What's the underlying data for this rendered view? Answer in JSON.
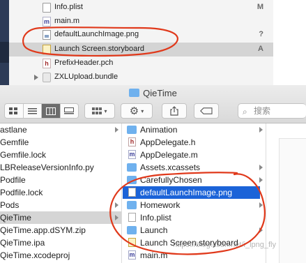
{
  "navigator": {
    "items": [
      {
        "label": "Info.plist",
        "badge": "M",
        "icon": "plist-file-icon"
      },
      {
        "label": "main.m",
        "badge": "",
        "icon": "m-file-icon"
      },
      {
        "label": "defaultLaunchImage.png",
        "badge": "?",
        "icon": "png-file-icon"
      },
      {
        "label": "Launch Screen.storyboard",
        "badge": "A",
        "icon": "storyboard-file-icon"
      },
      {
        "label": "PrefixHeader.pch",
        "badge": "",
        "icon": "h-file-icon"
      },
      {
        "label": "ZXLUpload.bundle",
        "badge": "",
        "icon": "bundle-icon"
      }
    ],
    "selected_index": 3
  },
  "finder": {
    "title": "QieTime",
    "search_placeholder": "搜索",
    "toolbar": {
      "view_modes": [
        "icon-view",
        "list-view",
        "column-view",
        "cover-flow-view"
      ],
      "active_view": "column-view",
      "arrange_icon": "grid-arrange-icon",
      "action_icon": "gear-icon",
      "share_icon": "share-icon",
      "tag_icon": "tag-icon"
    },
    "column1": [
      {
        "label": "astlane",
        "has_children": true
      },
      {
        "label": "Gemfile",
        "has_children": false
      },
      {
        "label": "Gemfile.lock",
        "has_children": false
      },
      {
        "label": "LBReleaseVersionInfo.py",
        "has_children": false
      },
      {
        "label": "Podfile",
        "has_children": false
      },
      {
        "label": "Podfile.lock",
        "has_children": false
      },
      {
        "label": "Pods",
        "has_children": true
      },
      {
        "label": "QieTime",
        "has_children": true
      },
      {
        "label": "QieTime.app.dSYM.zip",
        "has_children": false
      },
      {
        "label": "QieTime.ipa",
        "has_children": false
      },
      {
        "label": "QieTime.xcodeproj",
        "has_children": false
      }
    ],
    "column1_selected": 7,
    "column2": [
      {
        "label": "Animation",
        "kind": "folder",
        "has_children": true
      },
      {
        "label": "AppDelegate.h",
        "kind": "h",
        "has_children": false
      },
      {
        "label": "AppDelegate.m",
        "kind": "m",
        "has_children": false
      },
      {
        "label": "Assets.xcassets",
        "kind": "folder",
        "has_children": true
      },
      {
        "label": "CarefullyChosen",
        "kind": "folder",
        "has_children": true
      },
      {
        "label": "defaultLaunchImage.png",
        "kind": "png",
        "has_children": false
      },
      {
        "label": "Homework",
        "kind": "folder",
        "has_children": true
      },
      {
        "label": "Info.plist",
        "kind": "doc",
        "has_children": false
      },
      {
        "label": "Launch",
        "kind": "folder",
        "has_children": true
      },
      {
        "label": "Launch Screen.storyboard",
        "kind": "storyboard",
        "has_children": false
      },
      {
        "label": "main.m",
        "kind": "m",
        "has_children": false
      }
    ],
    "column2_selected": 5
  },
  "watermark": "https://blog.csdn.net/i_lpng_fly",
  "colors": {
    "annotation": "#e0391b",
    "selection_blue": "#1b63d8",
    "folder_blue": "#6fb1ee"
  }
}
